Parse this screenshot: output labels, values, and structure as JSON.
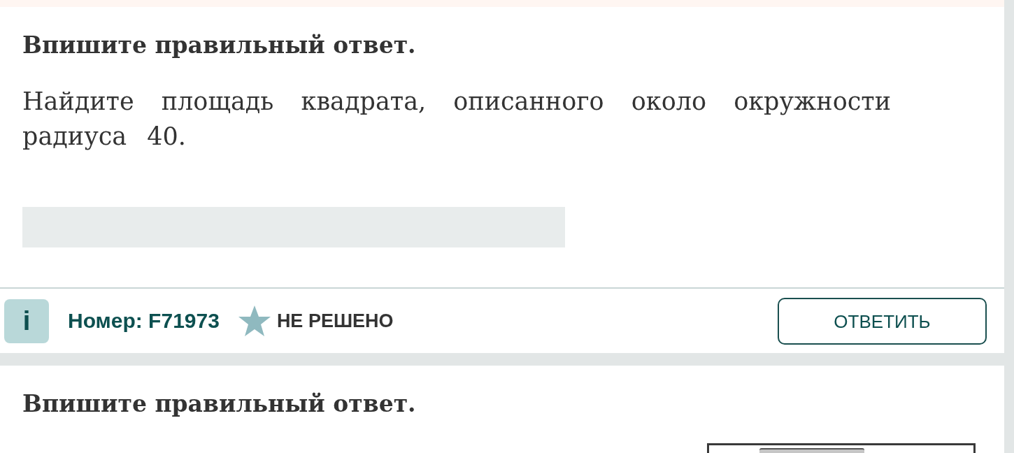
{
  "tasks": [
    {
      "kind": "text_answer",
      "instruction": "Впишите правильный ответ.",
      "question": "Найдите площадь квадрата, описанного около окружности радиуса 40.",
      "footer": {
        "info_badge": "i",
        "number": "Номер: F71973",
        "starred": false,
        "status": "НЕ РЕШЕНО",
        "button": "ОТВЕТИТЬ"
      }
    },
    {
      "kind": "figure",
      "instruction": "Впишите правильный ответ."
    }
  ]
}
